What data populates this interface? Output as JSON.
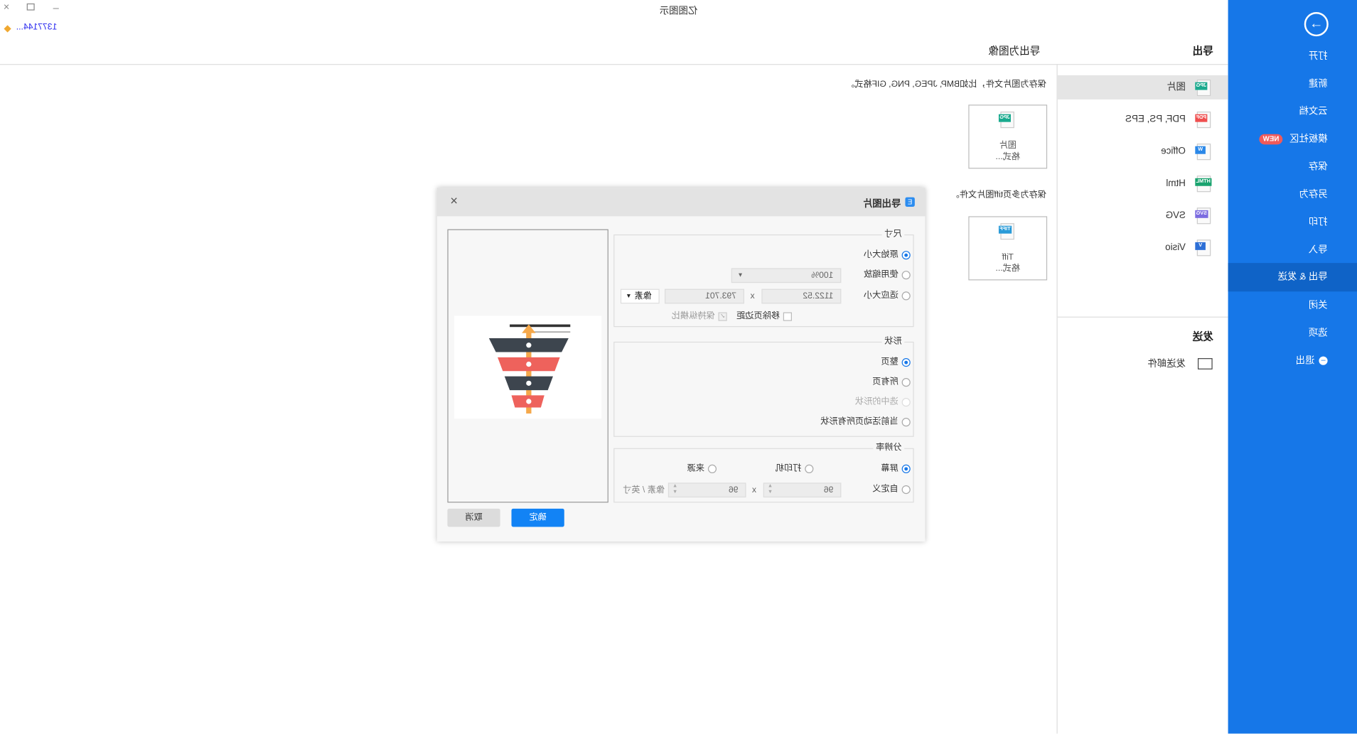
{
  "window": {
    "title": "亿图图示",
    "user": "1377144...",
    "controls": [
      "close",
      "restore",
      "minimize"
    ]
  },
  "sidebar": {
    "items": [
      {
        "label": "打开"
      },
      {
        "label": "新建"
      },
      {
        "label": "云文档"
      },
      {
        "label": "模板社区",
        "badge": "NEW"
      },
      {
        "label": "保存"
      },
      {
        "label": "另存为"
      },
      {
        "label": "打印"
      },
      {
        "label": "导入"
      },
      {
        "label": "导出 & 发送",
        "active": true
      },
      {
        "label": "关闭"
      },
      {
        "label": "选项"
      },
      {
        "label": "退出"
      }
    ]
  },
  "export_panel": {
    "heading": "导出",
    "items": [
      {
        "label": "图片",
        "tag": "JPG",
        "color": "#1aaa8e",
        "selected": true
      },
      {
        "label": "PDF, PS, EPS",
        "tag": "PDF",
        "color": "#ef4f4f"
      },
      {
        "label": "Office",
        "tag": "W",
        "color": "#2b88e8"
      },
      {
        "label": "Html",
        "tag": "HTML",
        "color": "#1aa36f"
      },
      {
        "label": "SVG",
        "tag": "SVG",
        "color": "#7b6be0"
      },
      {
        "label": "Visio",
        "tag": "V",
        "color": "#2d6fd6"
      }
    ],
    "send_heading": "发送",
    "send_items": [
      {
        "label": "发送邮件"
      }
    ]
  },
  "content": {
    "heading": "导出为图像",
    "desc1": "保存为图片文件，比如BMP, JPEG, PNG, GIF格式。",
    "card1": {
      "tag": "JPG",
      "line1": "图片",
      "line2": "格式..."
    },
    "desc2": "保存为多页tiff图片文件。",
    "card2": {
      "tag": "TIFF",
      "line1": "Tiff",
      "line2": "格式..."
    }
  },
  "dialog": {
    "title": "导出图片",
    "size": {
      "legend": "尺寸",
      "original": "原始大小",
      "use_zoom": "使用缩放",
      "zoom_value": "100%",
      "fit": "适应大小",
      "width": "1122.52",
      "x": "x",
      "height": "793.701",
      "unit": "像素",
      "remove_margin": "移除页边距",
      "keep_ratio": "保持纵横比",
      "selected": "original"
    },
    "shape": {
      "legend": "形状",
      "whole_page": "整页",
      "all_pages": "所有页",
      "selected_shapes": "选中的形状",
      "active_page_shapes": "当前活动页所有形状",
      "selected": "whole_page"
    },
    "resolution": {
      "legend": "分辨率",
      "screen": "屏幕",
      "printer": "打印机",
      "source": "来源",
      "custom": "自定义",
      "dpi_x": "96",
      "x": "x",
      "dpi_y": "96",
      "unit": "像素 / 英寸",
      "selected": "screen"
    },
    "ok": "确定",
    "cancel": "取消"
  },
  "colors": {
    "sidebar": "#1677e8",
    "sidebar_active": "#0f63c7",
    "primary_button": "#1283f5",
    "badge": "#f05a5a"
  }
}
